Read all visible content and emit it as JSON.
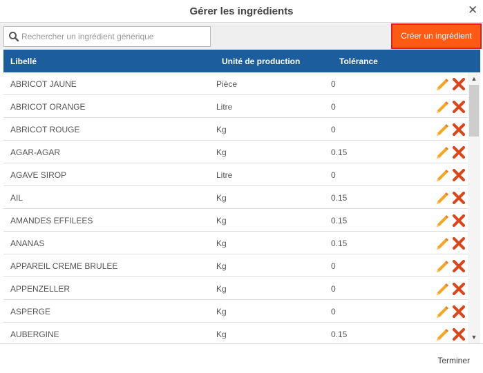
{
  "dialog": {
    "title": "Gérer les ingrédients"
  },
  "search": {
    "placeholder": "Rechercher un ingrédient générique",
    "value": ""
  },
  "create_button": "Créer un ingrédient",
  "columns": {
    "label": "Libellé",
    "unit": "Unité de production",
    "tolerance": "Tolérance"
  },
  "rows": [
    {
      "label": "ABRICOT JAUNE",
      "unit": "Pièce",
      "tolerance": "0"
    },
    {
      "label": "ABRICOT ORANGE",
      "unit": "Litre",
      "tolerance": "0"
    },
    {
      "label": "ABRICOT ROUGE",
      "unit": "Kg",
      "tolerance": "0"
    },
    {
      "label": "AGAR-AGAR",
      "unit": "Kg",
      "tolerance": "0.15"
    },
    {
      "label": "AGAVE SIROP",
      "unit": "Litre",
      "tolerance": "0"
    },
    {
      "label": "AIL",
      "unit": "Kg",
      "tolerance": "0.15"
    },
    {
      "label": "AMANDES EFFILEES",
      "unit": "Kg",
      "tolerance": "0.15"
    },
    {
      "label": "ANANAS",
      "unit": "Kg",
      "tolerance": "0.15"
    },
    {
      "label": "APPAREIL CREME BRULEE",
      "unit": "Kg",
      "tolerance": "0"
    },
    {
      "label": "APPENZELLER",
      "unit": "Kg",
      "tolerance": "0"
    },
    {
      "label": "ASPERGE",
      "unit": "Kg",
      "tolerance": "0"
    },
    {
      "label": "AUBERGINE",
      "unit": "Kg",
      "tolerance": "0.15"
    }
  ],
  "footer": {
    "finish_label": "Terminer"
  },
  "colors": {
    "header": "#1c5d9e",
    "create_button": "#ff5a13",
    "edit_icon": "#f39c12",
    "delete_icon": "#d9481c"
  },
  "icons": {
    "close": "close-icon",
    "search": "search-icon",
    "edit": "pencil-icon",
    "delete": "delete-icon"
  }
}
